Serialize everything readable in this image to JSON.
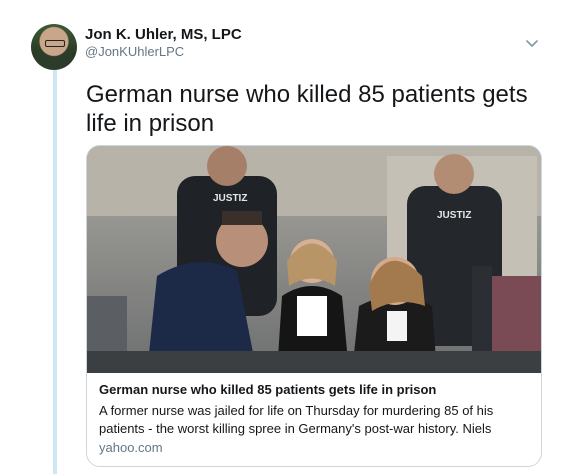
{
  "tweet": {
    "author_name": "Jon K. Uhler, MS, LPC",
    "author_handle": "@JonKUhlerLPC",
    "text": "German nurse who killed 85 patients gets life in prison",
    "avatar_icon": "profile-photo",
    "menu_icon": "chevron-down-icon"
  },
  "card": {
    "image_text_left_vest": "JUSTIZ",
    "image_text_right_vest": "JUSTIZ",
    "title": "German nurse who killed 85 patients gets life in prison",
    "description": "A former nurse was jailed for life on Thursday for murdering 85 of his patients - the worst killing spree in Germany's post-war history. Niels",
    "domain": "yahoo.com"
  },
  "colors": {
    "thread_line": "#cfe6f7",
    "secondary_text": "#657786",
    "card_border": "#ccd6dd"
  }
}
